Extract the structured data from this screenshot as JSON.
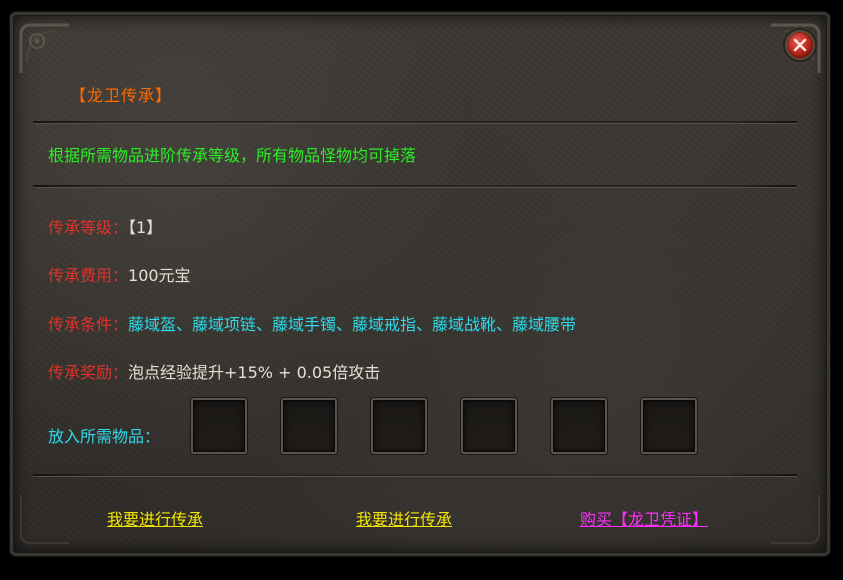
{
  "dialog": {
    "title": "【龙卫传承】",
    "description": "根据所需物品进阶传承等级，所有物品怪物均可掉落"
  },
  "info": {
    "level": {
      "label": "传承等级：",
      "value": "【1】"
    },
    "cost": {
      "label": "传承费用：",
      "value": "100元宝"
    },
    "condition": {
      "label": "传承条件：",
      "value": "藤域盔、藤域项链、藤域手镯、藤域戒指、藤域战靴、藤域腰带"
    },
    "reward": {
      "label": "传承奖励：",
      "value": "泡点经验提升+15% + 0.05倍攻击"
    }
  },
  "slots": {
    "label": "放入所需物品：",
    "count": 6
  },
  "actions": {
    "inherit_1": "我要进行传承",
    "inherit_2": "我要进行传承",
    "buy": "购买【龙卫凭证】"
  },
  "colors": {
    "title": "#ff6a00",
    "description": "#2bee26",
    "label": "#e2312b",
    "cyan": "#2fd9e8",
    "link_yellow": "#f2e600",
    "link_magenta": "#ff30ff"
  },
  "icons": {
    "close": "close-x-icon",
    "corner": "ornament-corner-icon"
  }
}
